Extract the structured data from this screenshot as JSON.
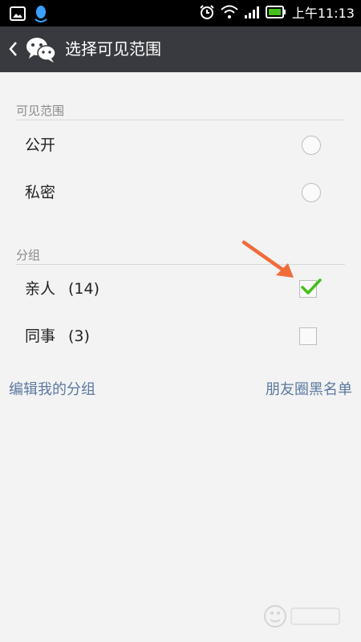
{
  "status_bar": {
    "time": "上午11:13",
    "icons": [
      "gallery-icon",
      "qq-icon",
      "alarm-icon",
      "wifi-icon",
      "signal-icon",
      "battery-icon"
    ]
  },
  "action_bar": {
    "title": "选择可见范围",
    "back_icon": "chevron-left-icon",
    "app_icon": "wechat-icon"
  },
  "visibility_section": {
    "header": "可见范围",
    "options": [
      {
        "label": "公开",
        "selected": false
      },
      {
        "label": "私密",
        "selected": false
      }
    ]
  },
  "group_section": {
    "header": "分组",
    "groups": [
      {
        "name": "亲人",
        "count": "(14)",
        "checked": true
      },
      {
        "name": "同事",
        "count": "(3)",
        "checked": false
      }
    ]
  },
  "footer": {
    "edit_groups": "编辑我的分组",
    "blacklist": "朋友圈黑名单"
  },
  "colors": {
    "action_bar": "#393a3f",
    "check": "#45c01a",
    "link": "#5b79a0",
    "annotation_arrow": "#f26b3a"
  }
}
